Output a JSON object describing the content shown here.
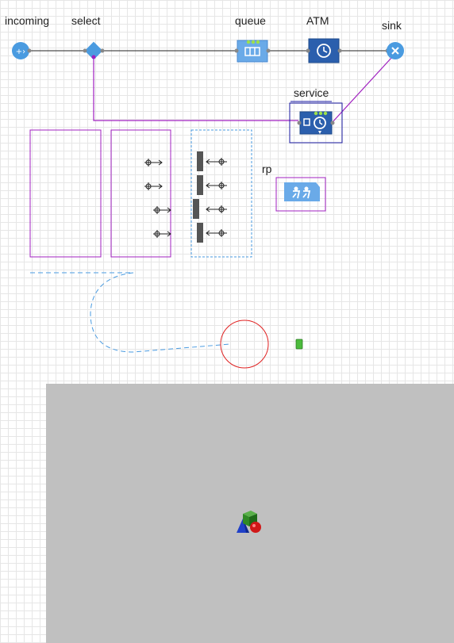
{
  "blocks": {
    "incoming": "incoming",
    "select": "select",
    "queue": "queue",
    "atm": "ATM",
    "sink": "sink",
    "service": "service",
    "rp": "rp"
  },
  "colors": {
    "block_blue": "#4a90d9",
    "block_dark_blue": "#2b5fad",
    "connector_purple": "#a020c0",
    "path_dashed_blue": "#4a9be0",
    "node_red": "#e02020",
    "area_3d": "#c0c0c0"
  },
  "icons": [
    "source-icon",
    "select-output-icon",
    "queue-icon",
    "delay-icon",
    "sink-icon",
    "service-icon",
    "resource-pool-icon",
    "3d-objects-icon"
  ]
}
